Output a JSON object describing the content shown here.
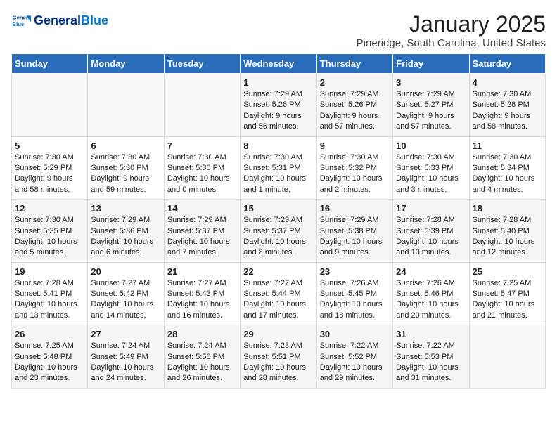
{
  "logo": {
    "text1": "General",
    "text2": "Blue"
  },
  "title": "January 2025",
  "subtitle": "Pineridge, South Carolina, United States",
  "days_of_week": [
    "Sunday",
    "Monday",
    "Tuesday",
    "Wednesday",
    "Thursday",
    "Friday",
    "Saturday"
  ],
  "weeks": [
    [
      {
        "num": "",
        "info": ""
      },
      {
        "num": "",
        "info": ""
      },
      {
        "num": "",
        "info": ""
      },
      {
        "num": "1",
        "info": "Sunrise: 7:29 AM\nSunset: 5:26 PM\nDaylight: 9 hours\nand 56 minutes."
      },
      {
        "num": "2",
        "info": "Sunrise: 7:29 AM\nSunset: 5:26 PM\nDaylight: 9 hours\nand 57 minutes."
      },
      {
        "num": "3",
        "info": "Sunrise: 7:29 AM\nSunset: 5:27 PM\nDaylight: 9 hours\nand 57 minutes."
      },
      {
        "num": "4",
        "info": "Sunrise: 7:30 AM\nSunset: 5:28 PM\nDaylight: 9 hours\nand 58 minutes."
      }
    ],
    [
      {
        "num": "5",
        "info": "Sunrise: 7:30 AM\nSunset: 5:29 PM\nDaylight: 9 hours\nand 58 minutes."
      },
      {
        "num": "6",
        "info": "Sunrise: 7:30 AM\nSunset: 5:30 PM\nDaylight: 9 hours\nand 59 minutes."
      },
      {
        "num": "7",
        "info": "Sunrise: 7:30 AM\nSunset: 5:30 PM\nDaylight: 10 hours\nand 0 minutes."
      },
      {
        "num": "8",
        "info": "Sunrise: 7:30 AM\nSunset: 5:31 PM\nDaylight: 10 hours\nand 1 minute."
      },
      {
        "num": "9",
        "info": "Sunrise: 7:30 AM\nSunset: 5:32 PM\nDaylight: 10 hours\nand 2 minutes."
      },
      {
        "num": "10",
        "info": "Sunrise: 7:30 AM\nSunset: 5:33 PM\nDaylight: 10 hours\nand 3 minutes."
      },
      {
        "num": "11",
        "info": "Sunrise: 7:30 AM\nSunset: 5:34 PM\nDaylight: 10 hours\nand 4 minutes."
      }
    ],
    [
      {
        "num": "12",
        "info": "Sunrise: 7:30 AM\nSunset: 5:35 PM\nDaylight: 10 hours\nand 5 minutes."
      },
      {
        "num": "13",
        "info": "Sunrise: 7:29 AM\nSunset: 5:36 PM\nDaylight: 10 hours\nand 6 minutes."
      },
      {
        "num": "14",
        "info": "Sunrise: 7:29 AM\nSunset: 5:37 PM\nDaylight: 10 hours\nand 7 minutes."
      },
      {
        "num": "15",
        "info": "Sunrise: 7:29 AM\nSunset: 5:37 PM\nDaylight: 10 hours\nand 8 minutes."
      },
      {
        "num": "16",
        "info": "Sunrise: 7:29 AM\nSunset: 5:38 PM\nDaylight: 10 hours\nand 9 minutes."
      },
      {
        "num": "17",
        "info": "Sunrise: 7:28 AM\nSunset: 5:39 PM\nDaylight: 10 hours\nand 10 minutes."
      },
      {
        "num": "18",
        "info": "Sunrise: 7:28 AM\nSunset: 5:40 PM\nDaylight: 10 hours\nand 12 minutes."
      }
    ],
    [
      {
        "num": "19",
        "info": "Sunrise: 7:28 AM\nSunset: 5:41 PM\nDaylight: 10 hours\nand 13 minutes."
      },
      {
        "num": "20",
        "info": "Sunrise: 7:27 AM\nSunset: 5:42 PM\nDaylight: 10 hours\nand 14 minutes."
      },
      {
        "num": "21",
        "info": "Sunrise: 7:27 AM\nSunset: 5:43 PM\nDaylight: 10 hours\nand 16 minutes."
      },
      {
        "num": "22",
        "info": "Sunrise: 7:27 AM\nSunset: 5:44 PM\nDaylight: 10 hours\nand 17 minutes."
      },
      {
        "num": "23",
        "info": "Sunrise: 7:26 AM\nSunset: 5:45 PM\nDaylight: 10 hours\nand 18 minutes."
      },
      {
        "num": "24",
        "info": "Sunrise: 7:26 AM\nSunset: 5:46 PM\nDaylight: 10 hours\nand 20 minutes."
      },
      {
        "num": "25",
        "info": "Sunrise: 7:25 AM\nSunset: 5:47 PM\nDaylight: 10 hours\nand 21 minutes."
      }
    ],
    [
      {
        "num": "26",
        "info": "Sunrise: 7:25 AM\nSunset: 5:48 PM\nDaylight: 10 hours\nand 23 minutes."
      },
      {
        "num": "27",
        "info": "Sunrise: 7:24 AM\nSunset: 5:49 PM\nDaylight: 10 hours\nand 24 minutes."
      },
      {
        "num": "28",
        "info": "Sunrise: 7:24 AM\nSunset: 5:50 PM\nDaylight: 10 hours\nand 26 minutes."
      },
      {
        "num": "29",
        "info": "Sunrise: 7:23 AM\nSunset: 5:51 PM\nDaylight: 10 hours\nand 28 minutes."
      },
      {
        "num": "30",
        "info": "Sunrise: 7:22 AM\nSunset: 5:52 PM\nDaylight: 10 hours\nand 29 minutes."
      },
      {
        "num": "31",
        "info": "Sunrise: 7:22 AM\nSunset: 5:53 PM\nDaylight: 10 hours\nand 31 minutes."
      },
      {
        "num": "",
        "info": ""
      }
    ]
  ]
}
